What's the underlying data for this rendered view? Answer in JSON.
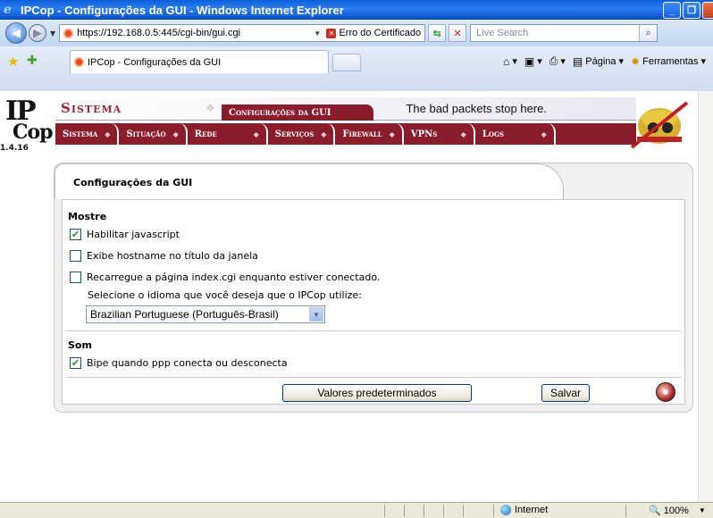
{
  "window": {
    "title": "IPCop - Configurações da GUI - Windows Internet Explorer"
  },
  "addressbar": {
    "url": "https://192.168.0.5:445/cgi-bin/gui.cgi",
    "cert_error": "Erro do Certificado",
    "search_placeholder": "Live Search"
  },
  "tabs": {
    "active_label": "IPCop - Configurações da GUI"
  },
  "commandbar": {
    "page_label": "Página",
    "tools_label": "Ferramentas"
  },
  "ipcop": {
    "logo_top": "IP",
    "logo_bottom": "Cop",
    "version": "1.4.16",
    "section_title": "Sistema",
    "subsection": "Configurações da GUI",
    "slogan": "The bad packets stop here.",
    "menu": [
      "Sistema",
      "Situação",
      "Rede",
      "Serviços",
      "Firewall",
      "VPNs",
      "Logs"
    ]
  },
  "form": {
    "title": "Configurações da GUI",
    "section_show": "Mostre",
    "enable_js": {
      "label": "Habilitar javascript",
      "checked": true
    },
    "hostname_title": {
      "label": "Exibe hostname no título da janela",
      "checked": false
    },
    "reload_index": {
      "label": "Recarregue a página index.cgi enquanto estiver conectado.",
      "checked": false
    },
    "language_prompt": "Selecione o idioma que você deseja que o IPCop utilize:",
    "language_value": "Brazilian Portuguese (Português-Brasil)",
    "section_sound": "Som",
    "beep": {
      "label": "Bipe quando ppp conecta ou desconecta",
      "checked": true
    },
    "defaults_button": "Valores predeterminados",
    "save_button": "Salvar"
  },
  "statusbar": {
    "zone": "Internet",
    "zoom": "100%"
  },
  "colors": {
    "ipcop_red": "#8a1c2c",
    "xp_blue": "#0a5fd8"
  }
}
